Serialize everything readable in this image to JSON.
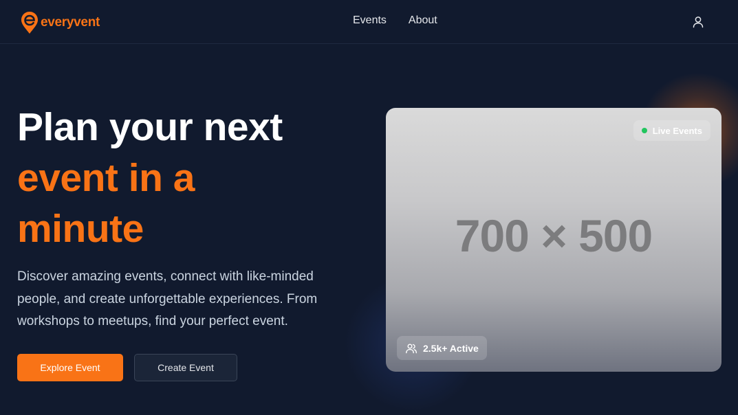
{
  "brand": {
    "name": "everyvent",
    "accent_color": "#f97316"
  },
  "nav": {
    "items": [
      {
        "label": "Events"
      },
      {
        "label": "About"
      }
    ],
    "user_icon": "user-icon"
  },
  "hero": {
    "title_line1": "Plan your next",
    "title_line2": "event in a",
    "title_line3": "minute",
    "description": "Discover amazing events, connect with like-minded people, and create unforgettable experiences. From workshops to meetups, find your perfect event.",
    "primary_button": "Explore Event",
    "secondary_button": "Create Event"
  },
  "card": {
    "placeholder_text": "700 × 500",
    "live_badge": "Live Events",
    "live_dot_color": "#22c55e",
    "active_badge": "2.5k+ Active",
    "active_icon": "users-icon"
  }
}
